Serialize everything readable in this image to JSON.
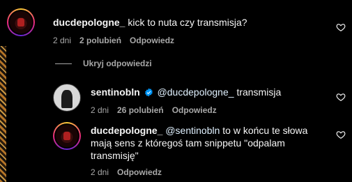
{
  "comment": {
    "username": "ducdepologne_",
    "text": "kick to nuta czy transmisja?",
    "time": "2 dni",
    "likes": "2 polubień",
    "reply_label": "Odpowiedz"
  },
  "hide_replies_label": "Ukryj odpowiedzi",
  "replies": [
    {
      "username": "sentinobln",
      "verified": true,
      "mention": "@ducdepologne_",
      "text": "transmisja",
      "time": "2 dni",
      "likes": "26 polubień",
      "reply_label": "Odpowiedz"
    },
    {
      "username": "ducdepologne_",
      "mention": "@sentinobln",
      "text_line1": "to w końcu te słowa",
      "text_line2": "mają sens z któregoś tam snippetu \"odpalam",
      "text_line3": "transmisję\"",
      "time": "2 dni",
      "reply_label": "Odpowiedz"
    }
  ],
  "colors": {
    "background": "#000000",
    "text": "#f5f5f5",
    "secondary": "#a8a8a8",
    "verified": "#0095f6"
  },
  "icons": {
    "like": "heart-outline-icon",
    "verified": "verified-badge-icon"
  }
}
